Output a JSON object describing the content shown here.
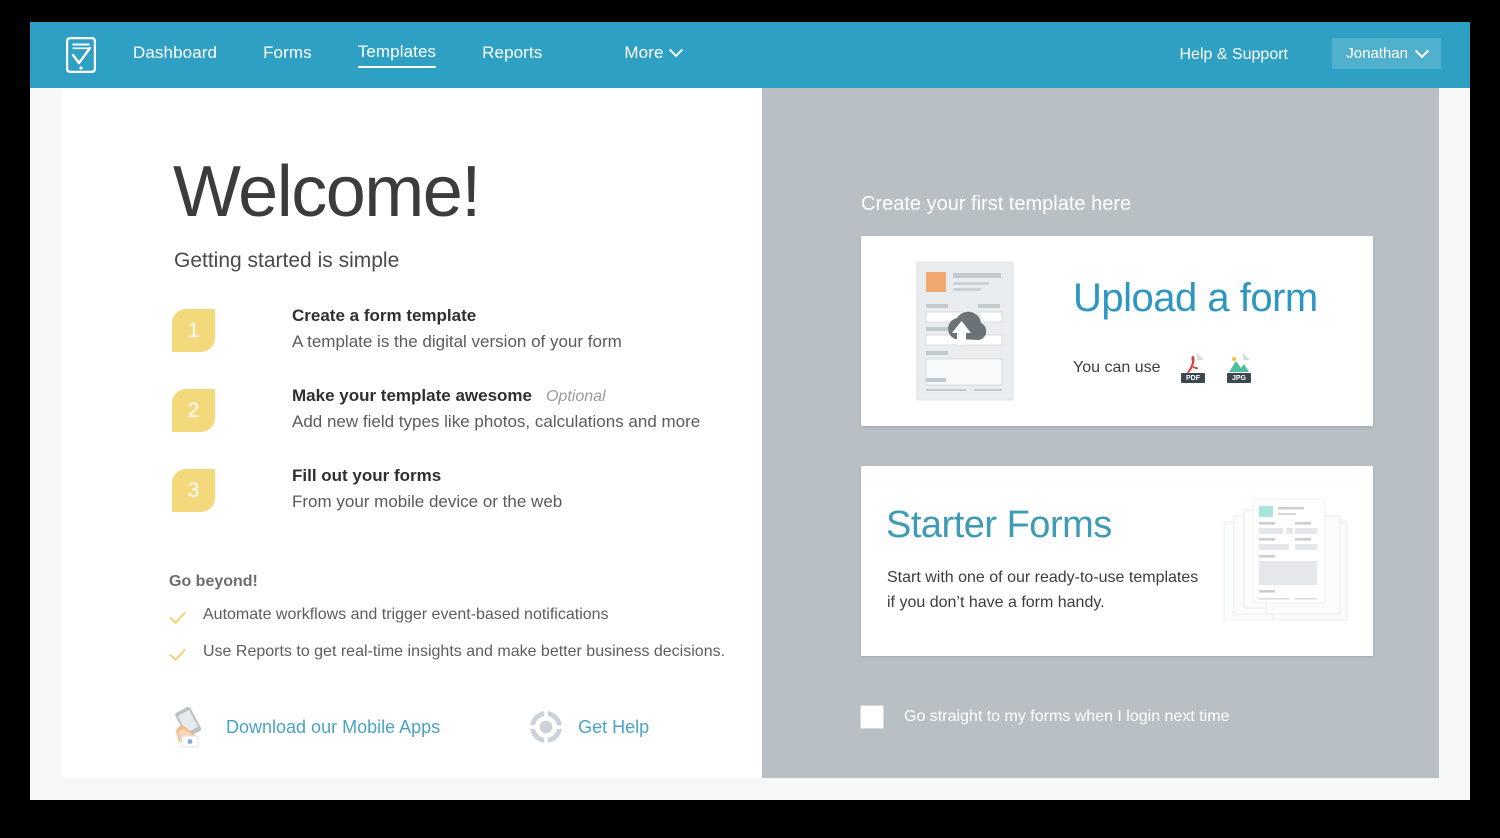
{
  "colors": {
    "brand_blue": "#2ea0c4",
    "link_blue": "#4aa3c4",
    "upload_title_blue": "#2d97c1",
    "starter_title_blue": "#3f9bb5",
    "badge_yellow": "#f4d87c",
    "right_panel_gray": "#b8c0c6",
    "page_bg": "#f7f8f8"
  },
  "topnav": {
    "logo_icon": "tablet-checklist-logo-icon",
    "links": [
      {
        "label": "Dashboard",
        "active": false
      },
      {
        "label": "Forms",
        "active": false
      },
      {
        "label": "Templates",
        "active": true
      },
      {
        "label": "Reports",
        "active": false
      }
    ],
    "more": {
      "label": "More",
      "icon": "chevron-down-icon"
    },
    "help_support": "Help & Support",
    "user": {
      "name": "Jonathan",
      "icon": "chevron-down-icon"
    }
  },
  "left": {
    "title": "Welcome!",
    "subtitle": "Getting started is simple",
    "steps": [
      {
        "number": "1",
        "title": "Create a form template",
        "optional": "",
        "desc": "A template is the digital version of your form"
      },
      {
        "number": "2",
        "title": "Make your template awesome",
        "optional": "Optional",
        "desc": "Add new field types like photos, calculations and more"
      },
      {
        "number": "3",
        "title": "Fill out your forms",
        "optional": "",
        "desc": "From your mobile device or the web"
      }
    ],
    "go_beyond_heading": "Go beyond!",
    "go_beyond_items": [
      "Automate workflows and trigger event-based notifications",
      "Use Reports to get real-time insights and make better business decisions."
    ],
    "mobile_link": {
      "label": "Download our Mobile Apps",
      "icon": "hand-holding-phone-icon"
    },
    "help_link": {
      "label": "Get Help",
      "icon": "life-ring-icon"
    }
  },
  "right": {
    "heading": "Create your first template here",
    "upload_card": {
      "title": "Upload a form",
      "use_text": "You can use",
      "doc_icon": "document-cloud-upload-icon",
      "file_types": [
        {
          "label": "PDF",
          "icon": "pdf-file-icon"
        },
        {
          "label": "JPG",
          "icon": "jpg-file-icon"
        }
      ]
    },
    "starter_card": {
      "title": "Starter Forms",
      "desc": "Start with one of our ready-to-use templates if you don’t have a form handy.",
      "art_icon": "stacked-documents-icon"
    },
    "preference": {
      "label": "Go straight to my forms when I login next time",
      "checked": false
    }
  }
}
